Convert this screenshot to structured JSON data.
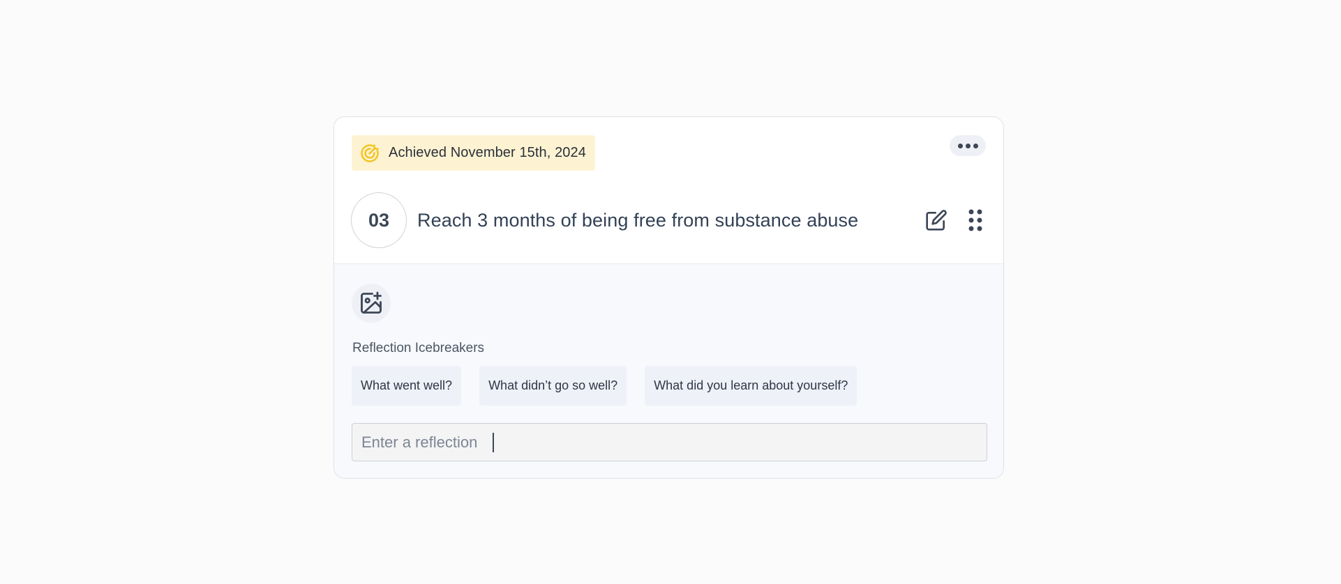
{
  "goal_card": {
    "achieved_label": "Achieved November 15th, 2024",
    "number": "03",
    "title": "Reach 3 months of being free from substance abuse",
    "icons": {
      "achieved": "target-icon",
      "more": "more-horizontal-icon",
      "edit": "edit-icon",
      "drag": "drag-handle-icon",
      "add_image": "image-plus-icon"
    },
    "colors": {
      "achieved_badge_bg": "#fdf3d3",
      "achieved_icon": "#f2c528",
      "text": "#334155"
    }
  },
  "reflection": {
    "section_label": "Reflection Icebreakers",
    "icebreakers": [
      "What went well?",
      "What didn’t go so well?",
      "What did you learn about yourself?"
    ],
    "input_placeholder": "Enter a reflection"
  }
}
